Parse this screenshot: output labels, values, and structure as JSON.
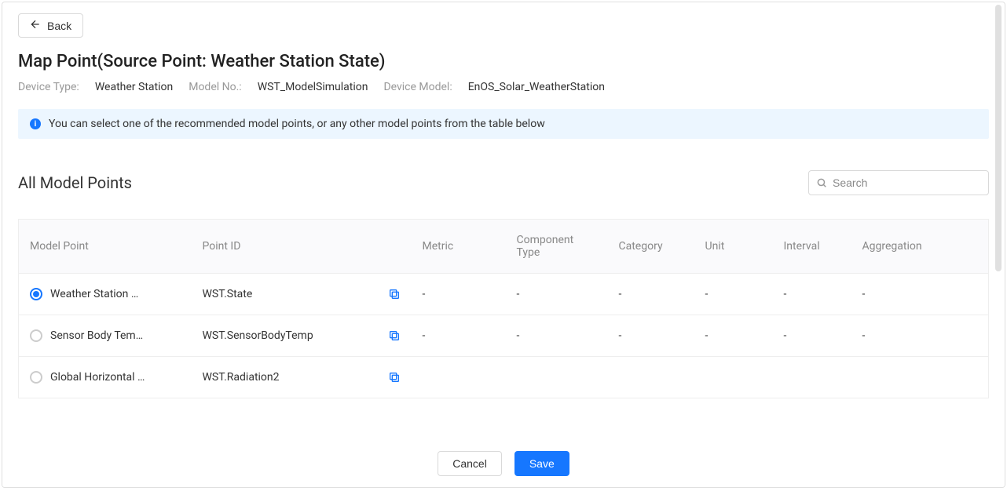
{
  "back_label": "Back",
  "page_title": "Map Point(Source Point: Weather Station State)",
  "meta": {
    "device_type_label": "Device Type:",
    "device_type_value": "Weather Station",
    "model_no_label": "Model No.:",
    "model_no_value": "WST_ModelSimulation",
    "device_model_label": "Device Model:",
    "device_model_value": "EnOS_Solar_WeatherStation"
  },
  "info_banner": "You can select one of the recommended model points, or any other model points from the table below",
  "section_title": "All Model Points",
  "search_placeholder": "Search",
  "table": {
    "columns": {
      "model_point": "Model Point",
      "point_id": "Point ID",
      "metric": "Metric",
      "component_type": "Component Type",
      "category": "Category",
      "unit": "Unit",
      "interval": "Interval",
      "aggregation": "Aggregation"
    },
    "rows": [
      {
        "selected": true,
        "model_point": "Weather Station …",
        "point_id": "WST.State",
        "metric": "-",
        "component_type": "-",
        "category": "-",
        "unit": "-",
        "interval": "-",
        "aggregation": "-"
      },
      {
        "selected": false,
        "model_point": "Sensor Body Tem…",
        "point_id": "WST.SensorBodyTemp",
        "metric": "-",
        "component_type": "-",
        "category": "-",
        "unit": "-",
        "interval": "-",
        "aggregation": "-"
      },
      {
        "selected": false,
        "model_point": "Global Horizontal …",
        "point_id": "WST.Radiation2",
        "metric": "",
        "component_type": "",
        "category": "",
        "unit": "",
        "interval": "",
        "aggregation": ""
      }
    ]
  },
  "footer": {
    "cancel": "Cancel",
    "save": "Save"
  }
}
